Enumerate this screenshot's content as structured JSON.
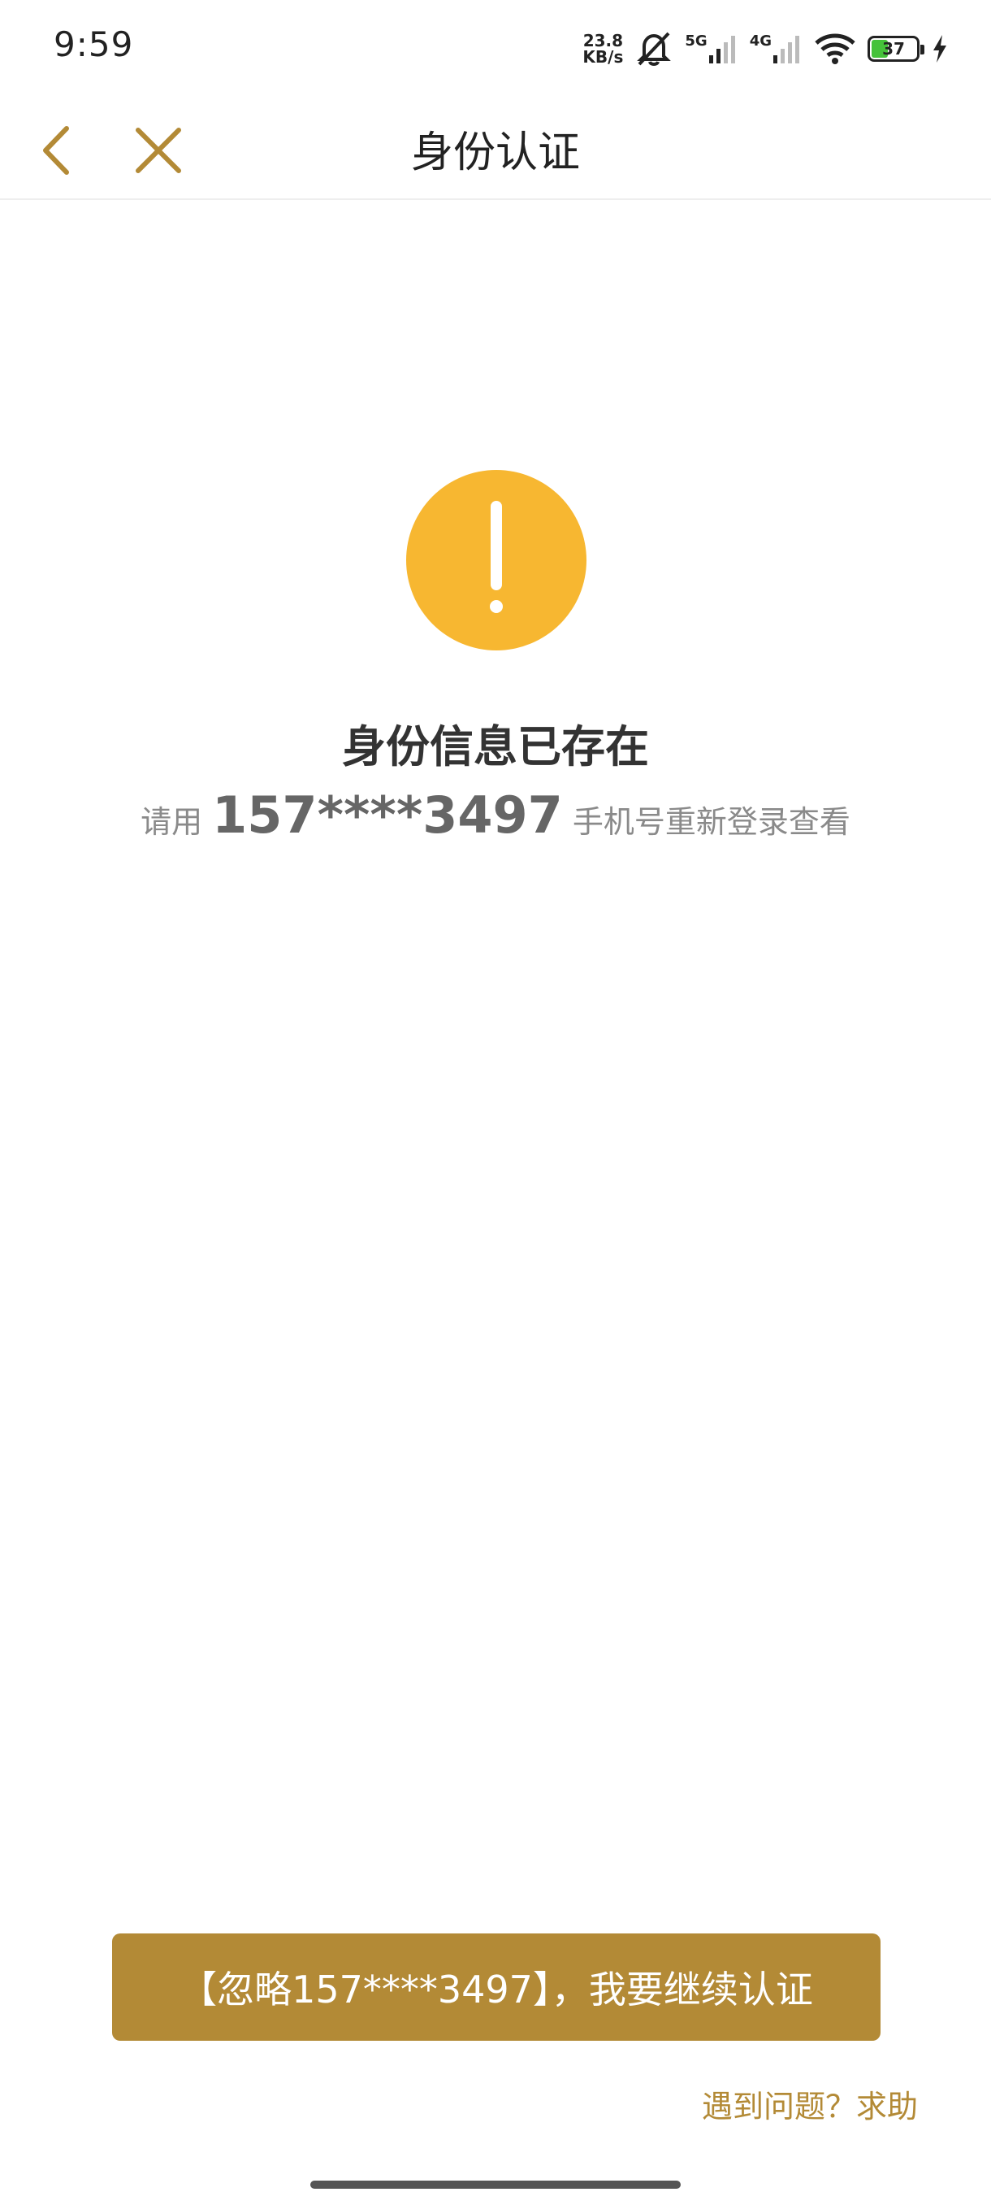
{
  "status_bar": {
    "time": "9:59",
    "net_speed_value": "23.8",
    "net_speed_unit": "KB/s",
    "signal_1_label": "5G",
    "signal_2_label": "4G",
    "battery_level": "37",
    "battery_fraction": 0.37,
    "battery_color": "#45c23a",
    "icons": [
      "mute-bell-icon",
      "signal-5g-icon",
      "signal-4g-icon",
      "wifi-icon",
      "battery-icon",
      "charging-icon"
    ]
  },
  "header": {
    "title": "身份认证",
    "back_icon": "chevron-left-icon",
    "close_icon": "close-icon",
    "accent_color": "#b38a36"
  },
  "main": {
    "warning_icon": "exclamation-circle-icon",
    "warning_color": "#f7b731",
    "title": "身份信息已存在",
    "hint_prefix": "请用",
    "hint_phone": "157****3497",
    "hint_suffix": "手机号重新登录查看"
  },
  "footer": {
    "continue_button_label": "【忽略157****3497】，我要继续认证",
    "help_link_label": "遇到问题？求助",
    "button_color": "#b38a36"
  }
}
